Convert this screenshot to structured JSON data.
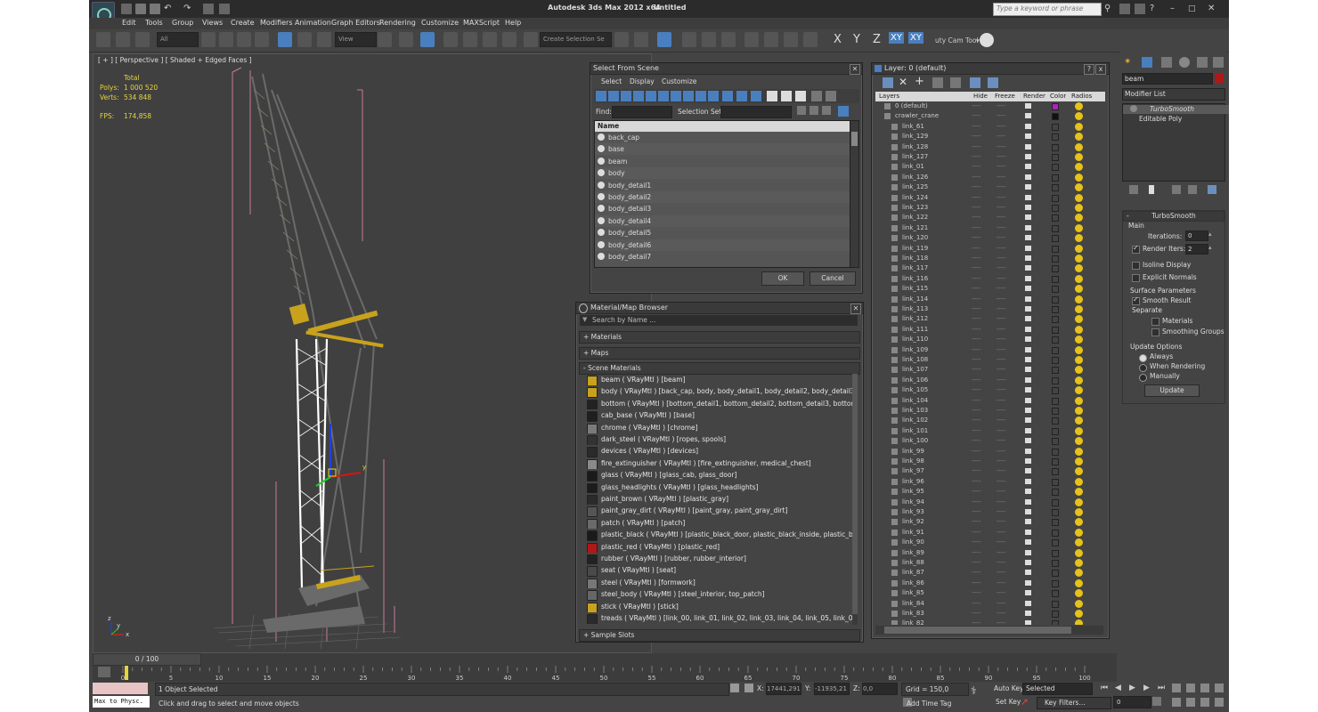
{
  "app": {
    "title": "Autodesk 3ds Max  2012 x64",
    "document": "Untitled",
    "search_placeholder": "Type a keyword or phrase"
  },
  "menu": [
    "Edit",
    "Tools",
    "Group",
    "Views",
    "Create",
    "Modifiers",
    "Animation",
    "Graph Editors",
    "Rendering",
    "Customize",
    "MAXScript",
    "Help"
  ],
  "toolbar": {
    "filter_value": "All",
    "view_value": "View",
    "selection_set_value": "Create Selection Se",
    "axis_labels": [
      "X",
      "Y",
      "Z",
      "XY",
      "XY"
    ],
    "cam_tool_label": "uty Cam Tool",
    "cam_tool_suffix": "▾"
  },
  "viewport": {
    "label": "[ + ] [ Perspective ] [ Shaded + Edged Faces ]",
    "stats_header": "Total",
    "polys_label": "Polys:",
    "polys_value": "1 000 520",
    "verts_label": "Verts:",
    "verts_value": "534 848",
    "fps_label": "FPS:",
    "fps_value": "174,858",
    "gizmo_y": "y",
    "axis_x": "x",
    "axis_y": "y",
    "axis_z": "z"
  },
  "select_from_scene": {
    "title": "Select From Scene",
    "tabs": [
      "Select",
      "Display",
      "Customize"
    ],
    "find_label": "Find:",
    "selection_set_label": "Selection Set:",
    "column_name": "Name",
    "items": [
      "back_cap",
      "base",
      "beam",
      "body",
      "body_detail1",
      "body_detail2",
      "body_detail3",
      "body_detail4",
      "body_detail5",
      "body_detail6",
      "body_detail7"
    ],
    "ok": "OK",
    "cancel": "Cancel"
  },
  "material_browser": {
    "title": "Material/Map Browser",
    "search_placeholder": "Search by Name ...",
    "sections": [
      "+ Materials",
      "+ Maps",
      "- Scene Materials",
      "+ Sample Slots"
    ],
    "materials": [
      {
        "text": "beam  ( VRayMtl ) [beam]",
        "color": "#c8a21c"
      },
      {
        "text": "body  ( VRayMtl ) [back_cap, body, body_detail1, body_detail2, body_detail3, b...",
        "color": "#c8a21c"
      },
      {
        "text": "bottom  ( VRayMtl ) [bottom_detail1, bottom_detail2, bottom_detail3, bottom_d...",
        "color": "#222222"
      },
      {
        "text": "cab_base  ( VRayMtl ) [base]",
        "color": "#1f1f1f"
      },
      {
        "text": "chrome  ( VRayMtl ) [chrome]",
        "color": "#7a7a7a"
      },
      {
        "text": "dark_steel  ( VRayMtl ) [ropes, spools]",
        "color": "#333333"
      },
      {
        "text": "devices  ( VRayMtl ) [devices]",
        "color": "#2a2a2a"
      },
      {
        "text": "fire_extinguisher  ( VRayMtl ) [fire_extinguisher, medical_chest]",
        "color": "#8a8a8a"
      },
      {
        "text": "glass  ( VRayMtl ) [glass_cab, glass_door]",
        "color": "#1a1a1a"
      },
      {
        "text": "glass_headlights  ( VRayMtl ) [glass_headlights]",
        "color": "#1c1c1c"
      },
      {
        "text": "paint_brown  ( VRayMtl ) [plastic_gray]",
        "color": "#2b2b2b"
      },
      {
        "text": "paint_gray_dirt  ( VRayMtl ) [paint_gray, paint_gray_dirt]",
        "color": "#555555"
      },
      {
        "text": "patch  ( VRayMtl ) [patch]",
        "color": "#6a6a6a"
      },
      {
        "text": "plastic_black  ( VRayMtl ) [plastic_black_door, plastic_black_inside, plastic_black...",
        "color": "#1a1a1a"
      },
      {
        "text": "plastic_red  ( VRayMtl ) [plastic_red]",
        "color": "#b01818"
      },
      {
        "text": "rubber  ( VRayMtl ) [rubber, rubber_interior]",
        "color": "#222222"
      },
      {
        "text": "seat  ( VRayMtl ) [seat]",
        "color": "#4a4a4a"
      },
      {
        "text": "steel  ( VRayMtl ) [formwork]",
        "color": "#777777"
      },
      {
        "text": "steel_body  ( VRayMtl ) [steel_interior, top_patch]",
        "color": "#666666"
      },
      {
        "text": "stick  ( VRayMtl ) [stick]",
        "color": "#c8a21c"
      },
      {
        "text": "treads  ( VRayMtl ) [link_00, link_01, link_02, link_03, link_04, link_05, link_06, l...",
        "color": "#2a2a2a"
      }
    ]
  },
  "layer_manager": {
    "title": "Layer: 0 (default)",
    "help": "?",
    "close": "x",
    "columns": [
      "Layers",
      "Hide",
      "Freeze",
      "Render",
      "Color",
      "Radios"
    ],
    "layers": [
      {
        "name": "0 (default)",
        "indent": 1,
        "color": "#b020c0"
      },
      {
        "name": "crawler_crane",
        "indent": 1,
        "color": "#111111"
      },
      {
        "name": "link_61",
        "indent": 2
      },
      {
        "name": "link_129",
        "indent": 2
      },
      {
        "name": "link_128",
        "indent": 2
      },
      {
        "name": "link_127",
        "indent": 2
      },
      {
        "name": "link_01",
        "indent": 2
      },
      {
        "name": "link_126",
        "indent": 2
      },
      {
        "name": "link_125",
        "indent": 2
      },
      {
        "name": "link_124",
        "indent": 2
      },
      {
        "name": "link_123",
        "indent": 2
      },
      {
        "name": "link_122",
        "indent": 2
      },
      {
        "name": "link_121",
        "indent": 2
      },
      {
        "name": "link_120",
        "indent": 2
      },
      {
        "name": "link_119",
        "indent": 2
      },
      {
        "name": "link_118",
        "indent": 2
      },
      {
        "name": "link_117",
        "indent": 2
      },
      {
        "name": "link_116",
        "indent": 2
      },
      {
        "name": "link_115",
        "indent": 2
      },
      {
        "name": "link_114",
        "indent": 2
      },
      {
        "name": "link_113",
        "indent": 2
      },
      {
        "name": "link_112",
        "indent": 2
      },
      {
        "name": "link_111",
        "indent": 2
      },
      {
        "name": "link_110",
        "indent": 2
      },
      {
        "name": "link_109",
        "indent": 2
      },
      {
        "name": "link_108",
        "indent": 2
      },
      {
        "name": "link_107",
        "indent": 2
      },
      {
        "name": "link_106",
        "indent": 2
      },
      {
        "name": "link_105",
        "indent": 2
      },
      {
        "name": "link_104",
        "indent": 2
      },
      {
        "name": "link_103",
        "indent": 2
      },
      {
        "name": "link_102",
        "indent": 2
      },
      {
        "name": "link_101",
        "indent": 2
      },
      {
        "name": "link_100",
        "indent": 2
      },
      {
        "name": "link_99",
        "indent": 2
      },
      {
        "name": "link_98",
        "indent": 2
      },
      {
        "name": "link_97",
        "indent": 2
      },
      {
        "name": "link_96",
        "indent": 2
      },
      {
        "name": "link_95",
        "indent": 2
      },
      {
        "name": "link_94",
        "indent": 2
      },
      {
        "name": "link_93",
        "indent": 2
      },
      {
        "name": "link_92",
        "indent": 2
      },
      {
        "name": "link_91",
        "indent": 2
      },
      {
        "name": "link_90",
        "indent": 2
      },
      {
        "name": "link_89",
        "indent": 2
      },
      {
        "name": "link_88",
        "indent": 2
      },
      {
        "name": "link_87",
        "indent": 2
      },
      {
        "name": "link_86",
        "indent": 2
      },
      {
        "name": "link_85",
        "indent": 2
      },
      {
        "name": "link_84",
        "indent": 2
      },
      {
        "name": "link_83",
        "indent": 2
      },
      {
        "name": "link_82",
        "indent": 2
      }
    ],
    "hide_dash": "----",
    "freeze_dash": "----"
  },
  "command_panel": {
    "object_name": "beam",
    "modifier_list": "Modifier List",
    "stack": [
      "TurboSmooth",
      "Editable Poly"
    ],
    "rollout_title": "TurboSmooth",
    "main_label": "Main",
    "iterations_label": "Iterations:",
    "iterations_value": "0",
    "render_iters_label": "Render Iters:",
    "render_iters_value": "2",
    "isoline_display": "Isoline Display",
    "explicit_normals": "Explicit Normals",
    "surface_parameters": "Surface Parameters",
    "smooth_result": "Smooth Result",
    "separate": "Separate",
    "materials": "Materials",
    "smoothing_groups": "Smoothing Groups",
    "update_options": "Update Options",
    "always": "Always",
    "when_rendering": "When Rendering",
    "manually": "Manually",
    "update_button": "Update",
    "sign_minus": "-",
    "check_mark": "✓",
    "spin_mark": "▴"
  },
  "timeline": {
    "frame_display": "0 / 100",
    "ticks": [
      "0",
      "5",
      "10",
      "15",
      "20",
      "25",
      "30",
      "35",
      "40",
      "45",
      "50",
      "55",
      "60",
      "65",
      "70",
      "75",
      "80",
      "85",
      "90",
      "95",
      "100"
    ],
    "tick_step": 5,
    "tick_max": 100
  },
  "status": {
    "maxscript": "Max to Physc.",
    "objects_selected": "1 Object Selected",
    "prompt": "Click and drag to select and move objects",
    "x_label": "X:",
    "x_value": "17441,291",
    "y_label": "Y:",
    "y_value": "-11935,21",
    "z_label": "Z:",
    "z_value": "0,0",
    "grid": "Grid = 150,0",
    "add_time_tag": "Add Time Tag",
    "auto_key": "Auto Key",
    "set_key": "Set Key",
    "selected": "Selected",
    "key_filters": "Key Filters...",
    "frame_value": "0"
  },
  "colors": {
    "crane_yellow": "#c8a21c",
    "viewport_bg": "#404040",
    "selection_blue": "#4a7fbf",
    "bbox_pink": "#c97a9a"
  }
}
